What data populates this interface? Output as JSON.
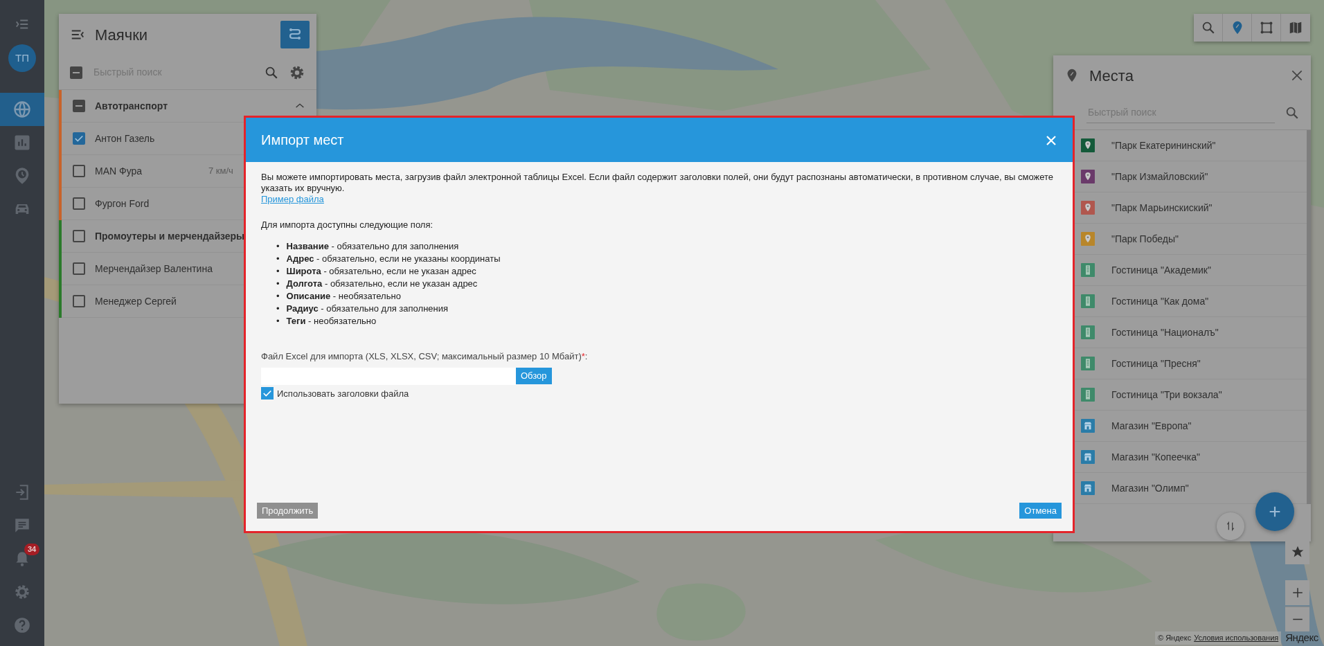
{
  "sidebar": {
    "avatar": "ТП",
    "nav": [
      {
        "selected": true
      },
      {
        "selected": false
      },
      {
        "selected": false
      },
      {
        "selected": false
      }
    ],
    "notifications": "34"
  },
  "beacons": {
    "title": "Маячки",
    "search_placeholder": "Быстрый поиск",
    "select_all": {
      "indeterminate": true
    },
    "groups": [
      {
        "name": "Автотранспорт",
        "color": "#c8632a",
        "indeterminate": true,
        "expanded": true,
        "items": [
          {
            "name": "Антон Газель",
            "checked": true
          },
          {
            "name": "MAN Фура",
            "checked": false,
            "speed": "7 км/ч"
          },
          {
            "name": "Фургон Ford",
            "checked": false
          }
        ]
      },
      {
        "name": "Промоутеры и мерчендайзеры",
        "color": "#2a7a2a",
        "checked": false,
        "items": [
          {
            "name": "Мерчендайзер Валентина",
            "checked": false
          },
          {
            "name": "Менеджер Сергей",
            "checked": false
          }
        ]
      }
    ]
  },
  "map_toolbar": [
    {
      "selected": false
    },
    {
      "selected": true
    },
    {
      "selected": false
    },
    {
      "selected": false
    }
  ],
  "places": {
    "title": "Места",
    "search_placeholder": "Быстрый поиск",
    "items": [
      {
        "name": "\"Парк Екатерининский\"",
        "kind": "park",
        "color": "#145a3a"
      },
      {
        "name": "\"Парк Измайловский\"",
        "kind": "park",
        "color": "#6a3a6a"
      },
      {
        "name": "\"Парк Марьинскиский\"",
        "kind": "park",
        "color": "#b0574e"
      },
      {
        "name": "\"Парк Победы\"",
        "kind": "park",
        "color": "#b8862a"
      },
      {
        "name": "Гостиница \"Академик\"",
        "kind": "hotel",
        "color": "#3f8a6a"
      },
      {
        "name": "Гостиница \"Как дома\"",
        "kind": "hotel",
        "color": "#3f8a6a"
      },
      {
        "name": "Гостиница \"Националъ\"",
        "kind": "hotel",
        "color": "#3f8a6a"
      },
      {
        "name": "Гостиница \"Пресня\"",
        "kind": "hotel",
        "color": "#3f8a6a"
      },
      {
        "name": "Гостиница \"Три вокзала\"",
        "kind": "hotel",
        "color": "#3f8a6a"
      },
      {
        "name": "Магазин \"Европа\"",
        "kind": "shop",
        "color": "#2a7ca8"
      },
      {
        "name": "Магазин \"Копеечка\"",
        "kind": "shop",
        "color": "#2a7ca8"
      },
      {
        "name": "Магазин \"Олимп\"",
        "kind": "shop",
        "color": "#2a7ca8"
      }
    ]
  },
  "attribution": {
    "copyright": "© Яндекс",
    "terms_link": "Условия использования",
    "logo": "Яндекс"
  },
  "modal": {
    "title": "Импорт мест",
    "intro": "Вы можете импортировать места, загрузив файл электронной таблицы Excel. Если файл содержит заголовки полей, они будут распознаны автоматически, в противном случае, вы сможете указать их вручную.",
    "sample_link": "Пример файла",
    "fields_intro": "Для импорта доступны следующие поля:",
    "bullet": "•",
    "fields": [
      "**Название** - обязательно для заполнения",
      "**Адрес** - обязательно, если не указаны координаты",
      "**Широта** - обязательно, если не указан адрес",
      "**Долгота** - обязательно, если не указан адрес",
      "**Описание** - необязательно",
      "**Радиус** - обязательно для заполнения",
      "**Теги** - необязательно"
    ],
    "file_label": "Файл Excel для импорта (XLS, XLSX, CSV; максимальный размер 10 Мбайт)",
    "required_mark": "*",
    "label_end": ":",
    "browse_button": "Обзор",
    "use_headers": {
      "label": "Использовать заголовки файла",
      "checked": true
    },
    "continue_button": {
      "label": "Продолжить",
      "disabled": true
    },
    "cancel_button": "Отмена"
  }
}
